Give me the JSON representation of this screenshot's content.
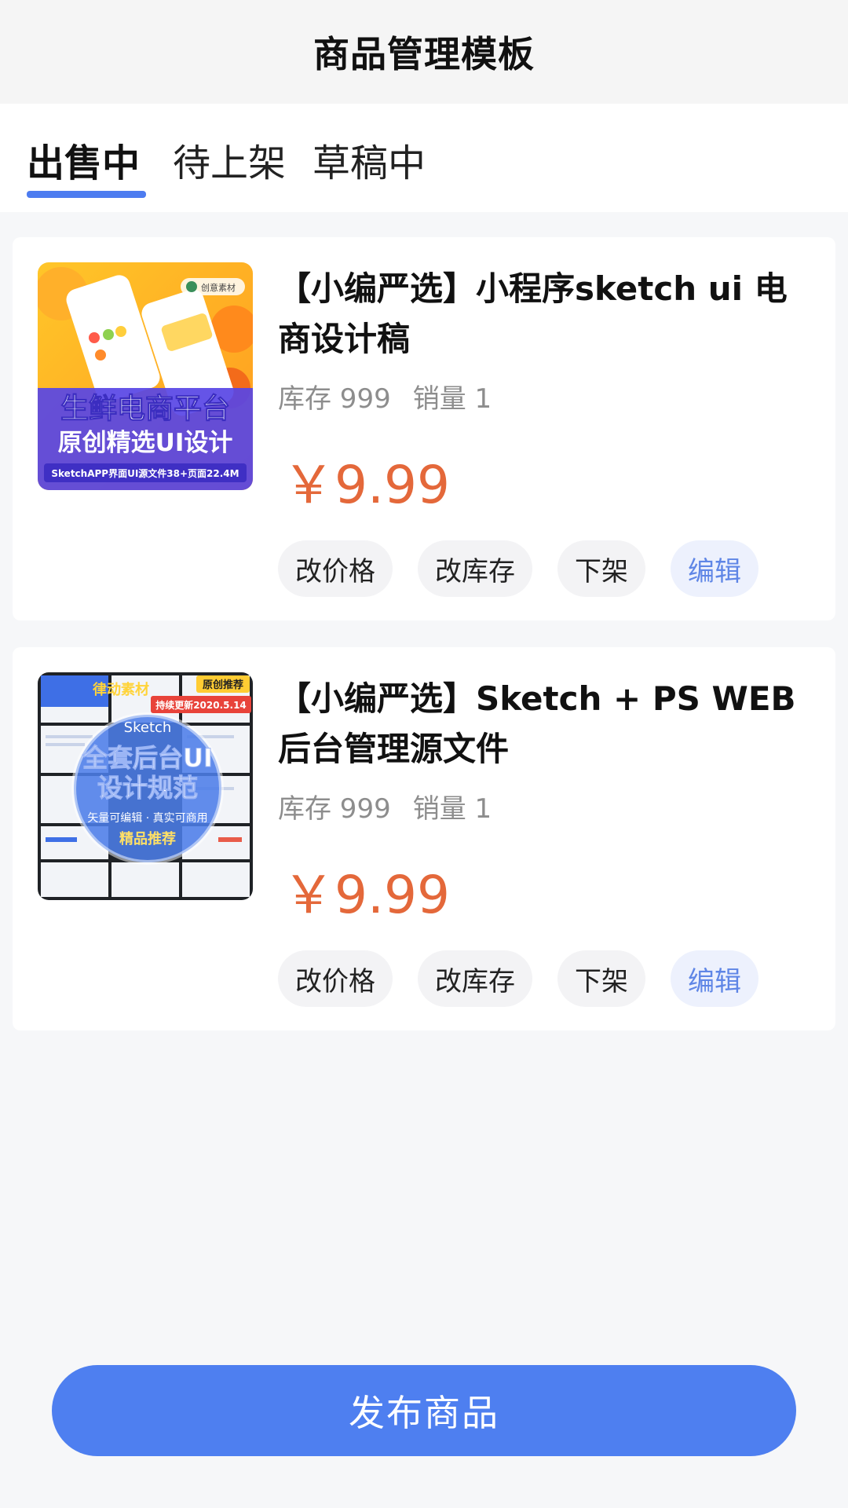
{
  "header": {
    "title": "商品管理模板"
  },
  "tabs": [
    {
      "label": "出售中",
      "active": true
    },
    {
      "label": "待上架",
      "active": false
    },
    {
      "label": "草稿中",
      "active": false
    }
  ],
  "products": [
    {
      "title": "【小编严选】小程序sketch ui 电商设计稿",
      "stock": "库存 999",
      "sales": "销量 1",
      "price": "￥9.99",
      "thumb": {
        "badge": "创意素材",
        "line1": "生鲜电商平台",
        "line2": "原创精选UI设计",
        "footer": "SketchAPP界面UI源文件38+页面22.4M"
      },
      "actions": {
        "price": "改价格",
        "stock": "改库存",
        "off": "下架",
        "edit": "编辑"
      }
    },
    {
      "title": "【小编严选】Sketch + PS WEB后台管理源文件",
      "stock": "库存 999",
      "sales": "销量 1",
      "price": "￥9.99",
      "thumb": {
        "brand": "律动素材",
        "tag1": "原创推荐",
        "tag2": "持续更新2020.5.14",
        "circle_top": "Sketch",
        "line1": "全套后台UI",
        "line2": "设计规范",
        "line3": "矢量可编辑 · 真实可商用",
        "line4": "精品推荐"
      },
      "actions": {
        "price": "改价格",
        "stock": "改库存",
        "off": "下架",
        "edit": "编辑"
      }
    }
  ],
  "publish_button": {
    "label": "发布商品"
  },
  "colors": {
    "accent": "#4e7ff0",
    "price": "#e4683a",
    "edit_text": "#5f86e6"
  }
}
